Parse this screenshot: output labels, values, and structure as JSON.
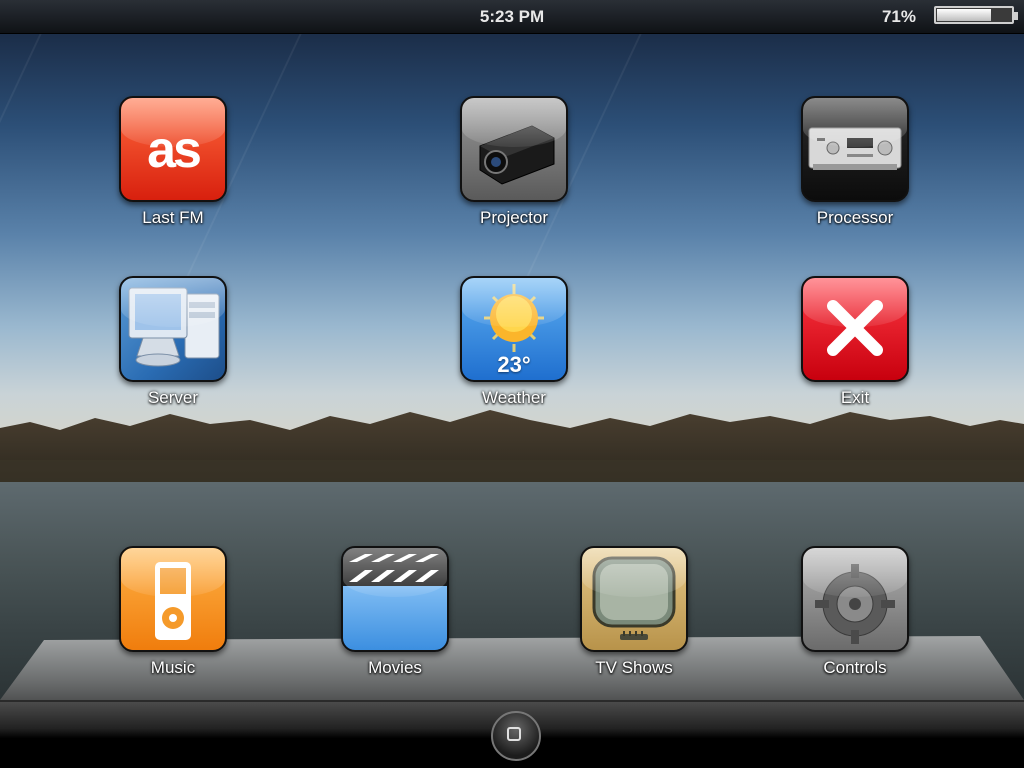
{
  "status_bar": {
    "time": "5:23 PM",
    "battery_percent_label": "71%",
    "battery_level": 0.71
  },
  "apps": {
    "lastfm": {
      "label": "Last FM",
      "glyph": "as",
      "icon": "lastfm-icon",
      "color": "#e8321c"
    },
    "projector": {
      "label": "Projector",
      "icon": "projector-icon"
    },
    "processor": {
      "label": "Processor",
      "icon": "processor-icon"
    },
    "server": {
      "label": "Server",
      "icon": "server-icon"
    },
    "weather": {
      "label": "Weather",
      "temp": "23°",
      "icon": "weather-sun-icon"
    },
    "exit": {
      "label": "Exit",
      "icon": "close-x-icon",
      "color": "#e0111c"
    }
  },
  "dock": {
    "music": {
      "label": "Music",
      "icon": "ipod-icon",
      "color": "#f7931e"
    },
    "movies": {
      "label": "Movies",
      "icon": "clapperboard-icon"
    },
    "tvshows": {
      "label": "TV Shows",
      "icon": "retro-tv-icon"
    },
    "controls": {
      "label": "Controls",
      "icon": "gear-icon"
    }
  }
}
